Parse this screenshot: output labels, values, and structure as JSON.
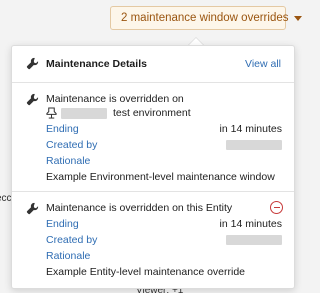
{
  "background": {
    "left_text": "ecc",
    "bottom_text": "Viewer: +1"
  },
  "trigger": {
    "label": "2 maintenance window overrides",
    "icon": "chevron-down-icon"
  },
  "popover": {
    "title": "Maintenance Details",
    "view_all": "View all",
    "sections": [
      {
        "heading": "Maintenance is overridden on",
        "env_suffix": "test environment",
        "fields": [
          {
            "label": "Ending",
            "value": "in 14 minutes"
          },
          {
            "label": "Created by",
            "value": ""
          },
          {
            "label": "Rationale",
            "value": ""
          }
        ],
        "description": "Example Environment-level maintenance window"
      },
      {
        "heading": "Maintenance is overridden on this Entity",
        "fields": [
          {
            "label": "Ending",
            "value": "in 14 minutes"
          },
          {
            "label": "Created by",
            "value": ""
          },
          {
            "label": "Rationale",
            "value": ""
          }
        ],
        "description": "Example Entity-level maintenance override",
        "remove_icon": "minus-circle-icon"
      }
    ]
  },
  "colors": {
    "link": "#2f6db3",
    "accent": "#9a5510",
    "danger": "#c73a3a"
  }
}
